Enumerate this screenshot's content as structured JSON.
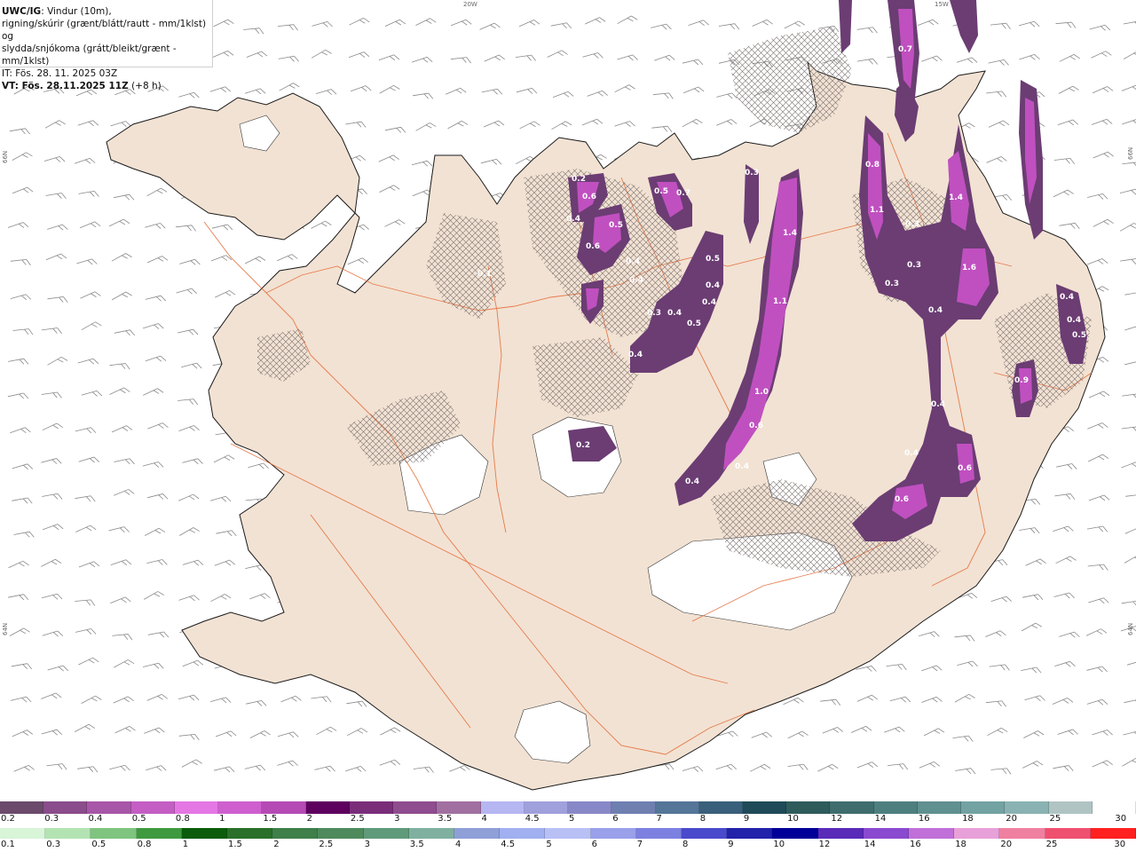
{
  "title": {
    "code": "UWC/IG",
    "line1_rest": ": Vindur (10m),",
    "line2": "rigning/skúrir (grænt/blátt/rautt - mm/1klst) og",
    "line3": "slydda/snjókoma (grátt/bleikt/grænt - mm/1klst)",
    "line4": "IT: Fös. 28. 11. 2025 03Z",
    "line5_bold": "VT: Fös. 28.11.2025 11Z",
    "line5_rest": " (+8 h)"
  },
  "grid_labels": {
    "top_left": "20W",
    "top_right": "15W",
    "left_top": "66N",
    "left_bottom": "64N",
    "right_top": "66N",
    "right_bottom": "64N"
  },
  "map_values": [
    "0.2",
    "0.6",
    "0.4",
    "0.6",
    "0.5",
    "0.4",
    "0.4",
    "0.1",
    "0.5",
    "0.7",
    "0.3",
    "1.4",
    "0.5",
    "0.4",
    "0.4",
    "0.3",
    "0.4",
    "0.5",
    "0.4",
    "1.1",
    "1.0",
    "0.6",
    "0.4",
    "0.4",
    "0.2",
    "0.8",
    "1.1",
    "0.3",
    "1.4",
    "1.6",
    "0.3",
    "0.3",
    "0.4",
    "0.4",
    "0.4",
    "0.6",
    "0.6",
    "0.4",
    "0.4",
    "0.5",
    "0.9",
    "0.7"
  ],
  "legend": {
    "snow": {
      "labels": [
        "0.2",
        "0.3",
        "0.4",
        "0.5",
        "0.8",
        "1",
        "1.5",
        "2",
        "2.5",
        "3",
        "3.5",
        "4",
        "4.5",
        "5",
        "6",
        "7",
        "8",
        "9",
        "10",
        "12",
        "14",
        "16",
        "18",
        "20",
        "25",
        "30"
      ],
      "colors": [
        "#6b4a6b",
        "#8a4c8a",
        "#a856a8",
        "#c45ec4",
        "#e477e4",
        "#cf5fcf",
        "#b54ab5",
        "#5e005e",
        "#7a2e7a",
        "#8f4c8f",
        "#a170a1",
        "#b6b6f2",
        "#a0a0dd",
        "#8888c8",
        "#6f7fb0",
        "#557599",
        "#3a5f7a",
        "#1f4a58",
        "#2f5b5b",
        "#3f6d6d",
        "#4e7f7f",
        "#609090",
        "#72a2a2",
        "#8ab2b2",
        "#b0c4c4",
        "#ffffff"
      ]
    },
    "rain": {
      "labels": [
        "0.1",
        "0.3",
        "0.5",
        "0.8",
        "1",
        "1.5",
        "2",
        "2.5",
        "3",
        "3.5",
        "4",
        "4.5",
        "5",
        "6",
        "7",
        "8",
        "9",
        "10",
        "12",
        "14",
        "16",
        "18",
        "20",
        "25",
        "30"
      ],
      "colors": [
        "#d8f5d8",
        "#b3e3b3",
        "#7fc47f",
        "#3f9a3f",
        "#0b5c0b",
        "#2a6f2a",
        "#3f7f4a",
        "#4f8a5c",
        "#5f9a7a",
        "#7fb0a0",
        "#8f9fd8",
        "#a0b0f0",
        "#b8c0f5",
        "#9aa0ea",
        "#7c80e0",
        "#4a4acc",
        "#2222aa",
        "#000099",
        "#5a2ab8",
        "#8a4ad0",
        "#c070d8",
        "#e8a0d8",
        "#f080a0",
        "#f05070",
        "#ff2020"
      ]
    }
  }
}
